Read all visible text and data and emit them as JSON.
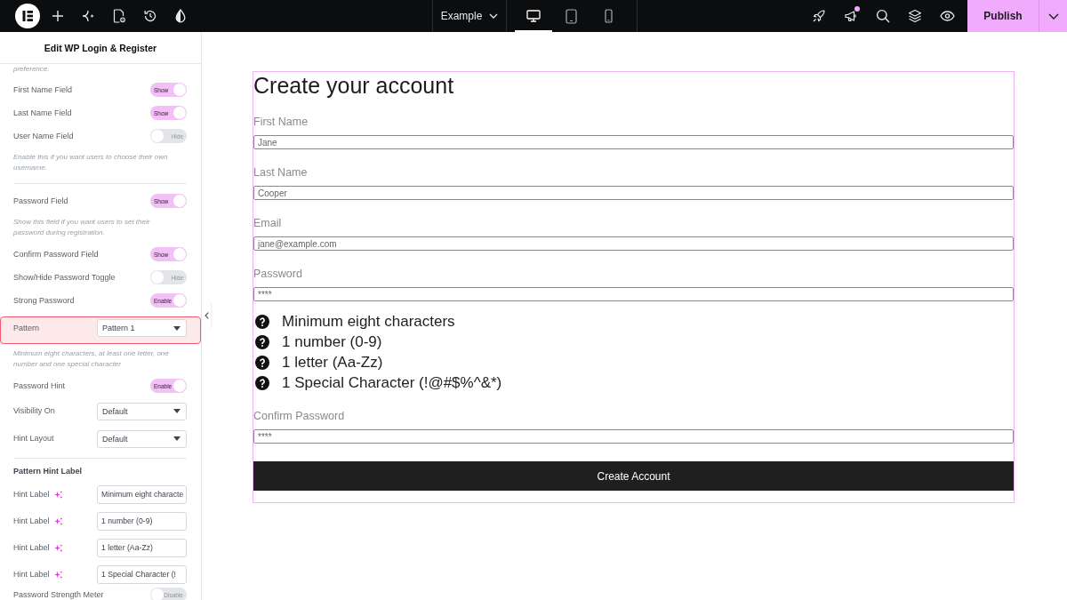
{
  "top_bar": {
    "page_title": "Example",
    "devices": [
      {
        "kind": "desktop",
        "selected": true
      },
      {
        "kind": "tablet",
        "selected": false
      },
      {
        "kind": "mobile",
        "selected": false
      }
    ],
    "notification": true,
    "publish_label": "Publish"
  },
  "panel": {
    "title": "Edit WP Login & Register",
    "items": [
      {
        "kind": "note",
        "text": "preference."
      },
      {
        "kind": "toggle",
        "label": "First Name Field",
        "on": true,
        "state_text": "Show"
      },
      {
        "kind": "toggle",
        "label": "Last Name Field",
        "on": true,
        "state_text": "Show"
      },
      {
        "kind": "toggle",
        "label": "User Name Field",
        "on": false,
        "state_text": "Hide"
      },
      {
        "kind": "note",
        "text": "Enable this if you want users to choose their own username."
      },
      {
        "kind": "divider"
      },
      {
        "kind": "toggle",
        "label": "Password Field",
        "on": true,
        "state_text": "Show"
      },
      {
        "kind": "note",
        "text": "Show this field if you want users to set their password during registration."
      },
      {
        "kind": "toggle",
        "label": "Confirm Password Field",
        "on": true,
        "state_text": "Show"
      },
      {
        "kind": "toggle",
        "label": "Show/Hide Password Toggle",
        "on": false,
        "state_text": "Hide"
      },
      {
        "kind": "toggle",
        "label": "Strong Password",
        "on": true,
        "state_text": "Enable"
      },
      {
        "kind": "select",
        "label": "Pattern",
        "value": "Pattern 1",
        "highlighted": true
      },
      {
        "kind": "note",
        "text": "Minimum eight characters, at least one letter, one number and one special character"
      },
      {
        "kind": "toggle",
        "label": "Password Hint",
        "on": true,
        "state_text": "Enable"
      },
      {
        "kind": "select",
        "label": "Visibility On",
        "value": "Default",
        "highlighted": false
      },
      {
        "kind": "select",
        "label": "Hint Layout",
        "value": "Default",
        "highlighted": false
      },
      {
        "kind": "divider"
      },
      {
        "kind": "heading",
        "text": "Pattern Hint Label"
      },
      {
        "kind": "text_input",
        "label": "Hint Label",
        "ai": true,
        "value": "Minimum eight characte"
      },
      {
        "kind": "text_input",
        "label": "Hint Label",
        "ai": true,
        "value": "1 number (0-9)"
      },
      {
        "kind": "text_input",
        "label": "Hint Label",
        "ai": true,
        "value": "1 letter (Aa-Zz)"
      },
      {
        "kind": "text_input",
        "label": "Hint Label",
        "ai": true,
        "value": "1 Special Character (!"
      },
      {
        "kind": "toggle",
        "label": "Password Strength Meter",
        "on": false,
        "state_text": "Disable"
      }
    ]
  },
  "form": {
    "title": "Create your account",
    "items": [
      {
        "kind": "field",
        "label": "First Name",
        "value": "Jane"
      },
      {
        "kind": "field",
        "label": "Last Name",
        "value": "Cooper"
      },
      {
        "kind": "field",
        "label": "Email",
        "value": "jane@example.com"
      },
      {
        "kind": "field",
        "label": "Password",
        "value": "****"
      },
      {
        "kind": "hints",
        "hints": [
          "Minimum eight characters",
          "1 number (0-9)",
          "1 letter (Aa-Zz)",
          "1 Special Character (!@#$%^&*)"
        ]
      },
      {
        "kind": "field",
        "label": "Confirm Password",
        "value": "****"
      }
    ],
    "button": "Create Account"
  }
}
